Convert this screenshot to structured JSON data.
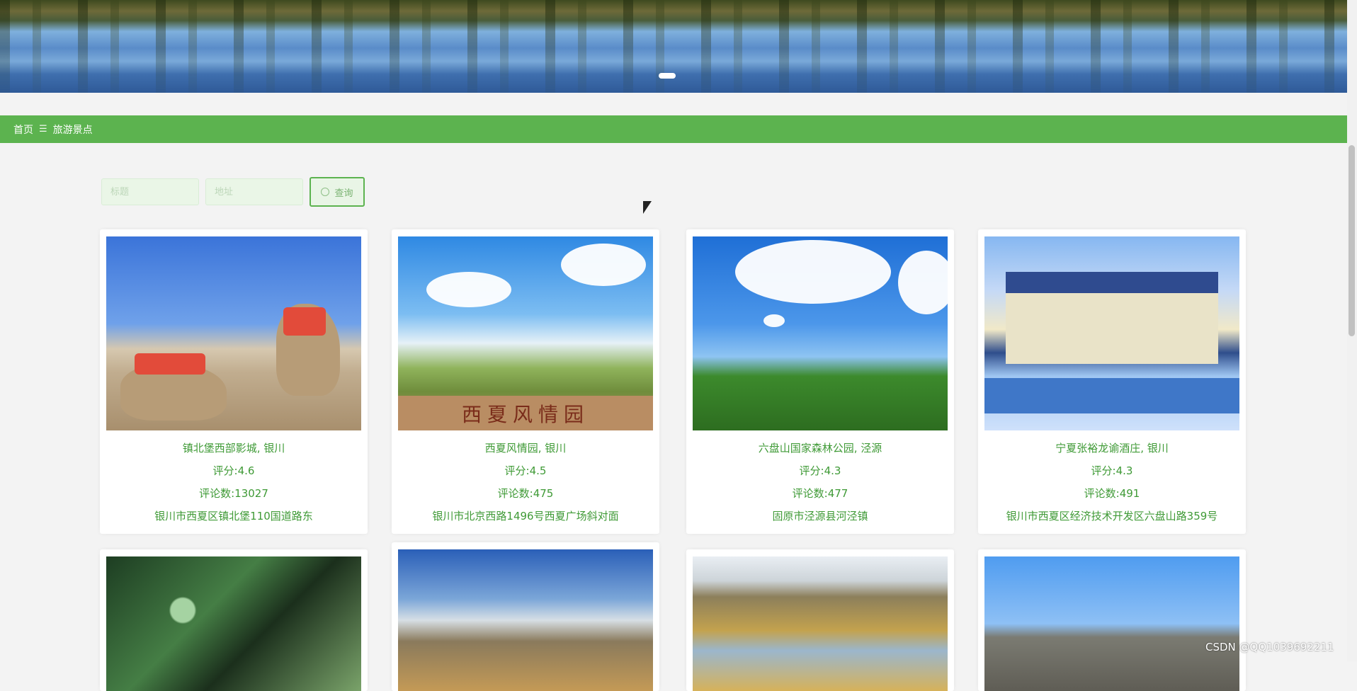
{
  "hero": {
    "carousel_active_index": 1,
    "carousel_total": 1
  },
  "breadcrumb": {
    "home": "首页",
    "separator": "☰",
    "current": "旅游景点"
  },
  "search": {
    "title_placeholder": "标题",
    "address_placeholder": "地址",
    "button_label": "查询"
  },
  "cards": [
    {
      "title": "镇北堡西部影城, 银川",
      "score": "评分:4.6",
      "comments": "评论数:13027",
      "address": "银川市西夏区镇北堡110国道路东"
    },
    {
      "title": "西夏风情园, 银川",
      "score": "评分:4.5",
      "comments": "评论数:475",
      "address": "银川市北京西路1496号西夏广场斜对面"
    },
    {
      "title": "六盘山国家森林公园, 泾源",
      "score": "评分:4.3",
      "comments": "评论数:477",
      "address": "固原市泾源县河泾镇"
    },
    {
      "title": "宁夏张裕龙谕酒庄, 银川",
      "score": "评分:4.3",
      "comments": "评论数:491",
      "address": "银川市西夏区经济技术开发区六盘山路359号"
    }
  ],
  "xixia_sign": "西夏风情园",
  "watermark": "CSDN @QQ1039692211",
  "colors": {
    "accent": "#5cb34f",
    "text_green": "#3f9a36"
  }
}
